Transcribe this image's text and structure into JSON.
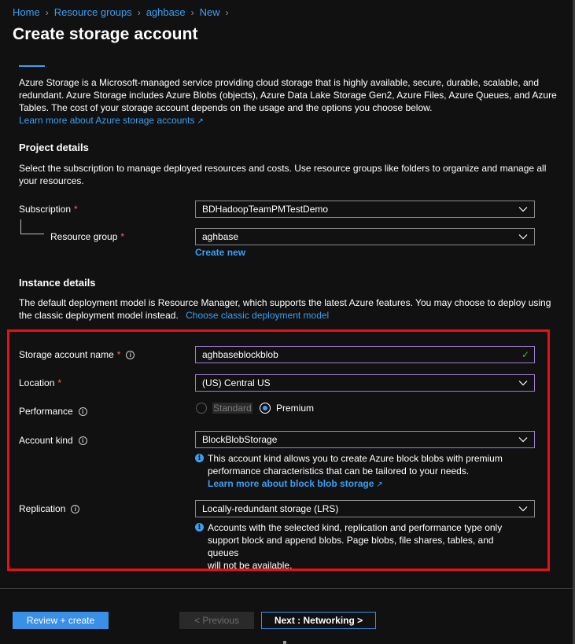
{
  "breadcrumb": [
    "Home",
    "Resource groups",
    "aghbase",
    "New"
  ],
  "page_title": "Create storage account",
  "intro": {
    "line1": "Azure Storage is a Microsoft-managed service providing cloud storage that is highly available, secure, durable, scalable, and",
    "line2": "redundant. Azure Storage includes Azure Blobs (objects), Azure Data Lake Storage Gen2, Azure Files, Azure Queues, and Azure",
    "line3": "Tables. The cost of your storage account depends on the usage and the options you choose below.",
    "link": "Learn more about Azure storage accounts"
  },
  "project": {
    "heading": "Project details",
    "desc1": "Select the subscription to manage deployed resources and costs. Use resource groups like folders to organize and manage all",
    "desc2": "your resources.",
    "subscription_label": "Subscription",
    "subscription_value": "BDHadoopTeamPMTestDemo",
    "resource_group_label": "Resource group",
    "resource_group_value": "aghbase",
    "create_new": "Create new"
  },
  "instance": {
    "heading": "Instance details",
    "desc1": "The default deployment model is Resource Manager, which supports the latest Azure features. You may choose to deploy using",
    "desc2": "the classic deployment model instead.",
    "classic_link": "Choose classic deployment model",
    "name_label": "Storage account name",
    "name_value": "aghbaseblockblob",
    "location_label": "Location",
    "location_value": "(US) Central US",
    "performance_label": "Performance",
    "perf_standard": "Standard",
    "perf_premium": "Premium",
    "account_kind_label": "Account kind",
    "account_kind_value": "BlockBlobStorage",
    "kind_info1": "This account kind allows you to create Azure block blobs with premium",
    "kind_info2": "performance characteristics that can be tailored to your needs.",
    "kind_info_link": "Learn more about block blob storage",
    "replication_label": "Replication",
    "replication_value": "Locally-redundant storage (LRS)",
    "repl_info1": "Accounts with the selected kind, replication and performance type only",
    "repl_info2": "support block and append blobs. Page blobs, file shares, tables, and queues",
    "repl_info3": "will not be available."
  },
  "footer": {
    "review": "Review + create",
    "previous": "< Previous",
    "next": "Next : Networking >"
  },
  "colors": {
    "accent": "#3aa0f3",
    "required": "#f16a6a",
    "highlight": "#e3121a",
    "valid": "#57a64a"
  }
}
